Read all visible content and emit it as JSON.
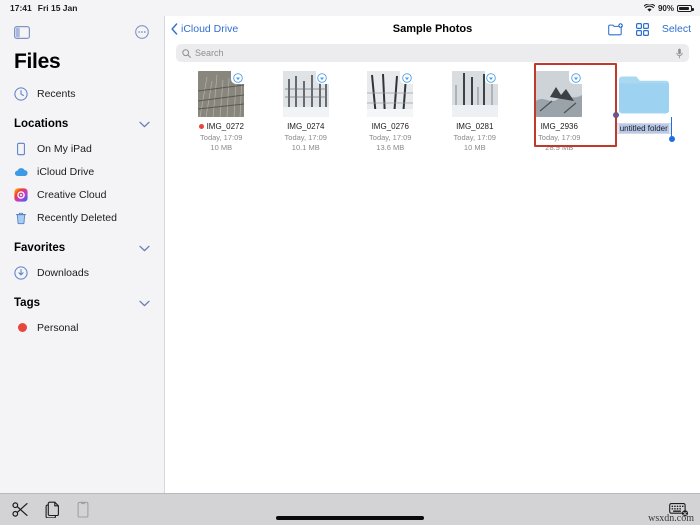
{
  "status_bar": {
    "time": "17:41",
    "date": "Fri 15 Jan",
    "battery_percent": "90%",
    "wifi_icon": "wifi-icon",
    "battery_icon": "battery-icon"
  },
  "sidebar": {
    "toggle_icon": "sidebar-toggle-icon",
    "more_icon": "ellipsis-circle-icon",
    "title": "Files",
    "recents": {
      "label": "Recents",
      "icon": "clock-icon"
    },
    "sections": [
      {
        "title": "Locations",
        "chevron": "∨",
        "items": [
          {
            "label": "On My iPad",
            "icon": "ipad-icon"
          },
          {
            "label": "iCloud Drive",
            "icon": "icloud-icon"
          },
          {
            "label": "Creative Cloud",
            "icon": "creative-cloud-icon"
          },
          {
            "label": "Recently Deleted",
            "icon": "trash-icon"
          }
        ]
      },
      {
        "title": "Favorites",
        "chevron": "∨",
        "items": [
          {
            "label": "Downloads",
            "icon": "download-circle-icon"
          }
        ]
      },
      {
        "title": "Tags",
        "chevron": "∨",
        "items": [
          {
            "label": "Personal",
            "icon": "tag-dot-icon",
            "color": "#e8453c"
          }
        ]
      }
    ]
  },
  "navbar": {
    "back_label": "iCloud Drive",
    "back_icon": "chevron-left-icon",
    "title": "Sample Photos",
    "new_folder_icon": "new-folder-icon",
    "grid_view_icon": "grid-view-icon",
    "select_label": "Select"
  },
  "search": {
    "placeholder": "Search",
    "search_icon": "search-icon",
    "mic_icon": "microphone-icon"
  },
  "files": [
    {
      "name": "IMG_0272",
      "date": "Today, 17:09",
      "size": "10 MB",
      "tag_color": "#e8453c",
      "cloud_badge": "icloud-download-icon"
    },
    {
      "name": "IMG_0274",
      "date": "Today, 17:09",
      "size": "10.1 MB",
      "tag_color": "",
      "cloud_badge": "icloud-download-icon"
    },
    {
      "name": "IMG_0276",
      "date": "Today, 17:09",
      "size": "13.6 MB",
      "tag_color": "",
      "cloud_badge": "icloud-download-icon"
    },
    {
      "name": "IMG_0281",
      "date": "Today, 17:09",
      "size": "10 MB",
      "tag_color": "",
      "cloud_badge": "icloud-download-icon"
    },
    {
      "name": "IMG_2936",
      "date": "Today, 17:09",
      "size": "28.9 MB",
      "tag_color": "",
      "cloud_badge": "icloud-download-icon"
    }
  ],
  "new_folder": {
    "name_value": "untitled folder",
    "folder_icon": "folder-icon",
    "highlight_color": "#c0392b",
    "selection_color": "#1f6fe0"
  },
  "bottom_toolbar": {
    "cut_icon": "scissors-icon",
    "copy_icon": "copy-icon",
    "paste_icon": "paste-icon",
    "keyboard_dismiss_icon": "keyboard-dismiss-icon"
  },
  "watermark": "wsxdn.com"
}
